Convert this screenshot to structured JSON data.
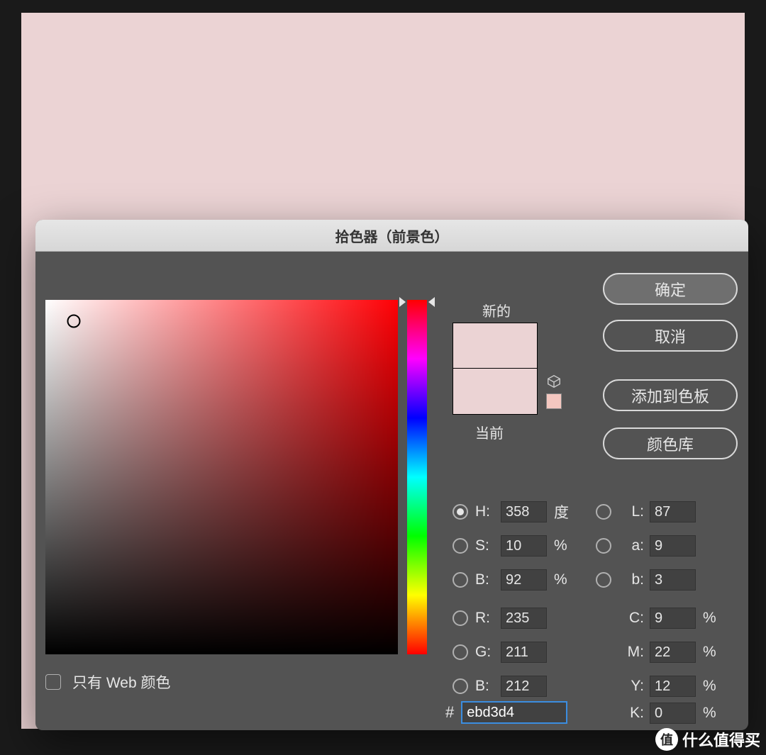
{
  "canvas_color": "#ebd3d4",
  "dialog": {
    "title": "拾色器（前景色）",
    "labels": {
      "new": "新的",
      "current": "当前"
    },
    "buttons": {
      "ok": "确定",
      "cancel": "取消",
      "add_swatch": "添加到色板",
      "color_libs": "颜色库"
    },
    "web_only": {
      "label": "只有 Web 颜色",
      "checked": false
    },
    "swatch": {
      "new": "#ebd3d4",
      "current": "#ebd3d4",
      "websafe": "#f4c7c0"
    },
    "hsb": {
      "h": {
        "label": "H:",
        "value": "358",
        "unit": "度",
        "selected": true
      },
      "s": {
        "label": "S:",
        "value": "10",
        "unit": "%"
      },
      "b": {
        "label": "B:",
        "value": "92",
        "unit": "%"
      }
    },
    "rgb": {
      "r": {
        "label": "R:",
        "value": "235"
      },
      "g": {
        "label": "G:",
        "value": "211"
      },
      "b": {
        "label": "B:",
        "value": "212"
      }
    },
    "lab": {
      "l": {
        "label": "L:",
        "value": "87"
      },
      "a": {
        "label": "a:",
        "value": "9"
      },
      "b": {
        "label": "b:",
        "value": "3"
      }
    },
    "cmyk": {
      "c": {
        "label": "C:",
        "value": "9",
        "unit": "%"
      },
      "m": {
        "label": "M:",
        "value": "22",
        "unit": "%"
      },
      "y": {
        "label": "Y:",
        "value": "12",
        "unit": "%"
      },
      "k": {
        "label": "K:",
        "value": "0",
        "unit": "%"
      }
    },
    "hex": {
      "label": "#",
      "value": "ebd3d4"
    }
  },
  "watermark": {
    "badge": "值",
    "text": "什么值得买"
  }
}
